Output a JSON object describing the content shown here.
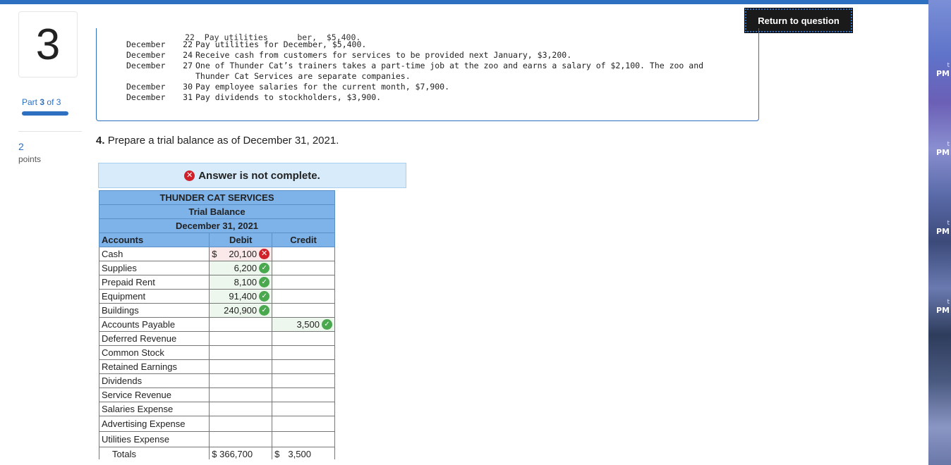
{
  "header": {
    "return_label": "Return to question"
  },
  "sidebar": {
    "question_number": "3",
    "part_prefix": "Part",
    "part_current": "3",
    "part_suffix": "of 3",
    "points_value": "2",
    "points_label": "points"
  },
  "problem": {
    "cut_line": "            22  Pay utilities      ber,  $5,400.",
    "entries": [
      {
        "month": "December",
        "day": "22",
        "text": "Pay utilities for December, $5,400."
      },
      {
        "month": "December",
        "day": "24",
        "text": "Receive cash from customers for services to be provided next January, $3,200."
      },
      {
        "month": "December",
        "day": "27",
        "text": "One of Thunder Cat’s trainers takes a part-time job at the zoo and earns a salary of $2,100. The zoo and Thunder Cat Services are separate companies."
      },
      {
        "month": "December",
        "day": "30",
        "text": "Pay employee salaries for the current month, $7,900."
      },
      {
        "month": "December",
        "day": "31",
        "text": "Pay dividends to stockholders, $3,900."
      }
    ]
  },
  "question": {
    "number": "4.",
    "text": "Prepare a trial balance as of December 31, 2021."
  },
  "feedback": {
    "status_text": "Answer is not complete."
  },
  "trial_balance": {
    "company": "THUNDER CAT SERVICES",
    "title": "Trial Balance",
    "date": "December 31, 2021",
    "col_accounts": "Accounts",
    "col_debit": "Debit",
    "col_credit": "Credit",
    "rows": [
      {
        "account": "Cash",
        "debit_sign": "$",
        "debit": "20,100",
        "credit": "",
        "status": "incorrect"
      },
      {
        "account": "Supplies",
        "debit": "6,200",
        "credit": "",
        "status": "correct"
      },
      {
        "account": "Prepaid Rent",
        "debit": "8,100",
        "credit": "",
        "status": "correct"
      },
      {
        "account": "Equipment",
        "debit": "91,400",
        "credit": "",
        "status": "correct"
      },
      {
        "account": "Buildings",
        "debit": "240,900",
        "credit": "",
        "status": "correct"
      },
      {
        "account": "Accounts Payable",
        "debit": "",
        "credit": "3,500",
        "status": "correct"
      },
      {
        "account": "Deferred Revenue",
        "debit": "",
        "credit": ""
      },
      {
        "account": "Common Stock",
        "debit": "",
        "credit": ""
      },
      {
        "account": "Retained Earnings",
        "debit": "",
        "credit": ""
      },
      {
        "account": "Dividends",
        "debit": "",
        "credit": ""
      },
      {
        "account": "Service Revenue",
        "debit": "",
        "credit": ""
      },
      {
        "account": "Salaries Expense",
        "debit": "",
        "credit": ""
      },
      {
        "account": "Advertising Expense",
        "debit": "",
        "credit": ""
      },
      {
        "account": "Utilities Expense",
        "debit": "",
        "credit": ""
      }
    ],
    "totals": {
      "label": "Totals",
      "debit": "$ 366,700",
      "credit_sign": "$",
      "credit": "3,500"
    }
  },
  "desktop_strip": {
    "labels": [
      "PM",
      "PM",
      "PM",
      "PM"
    ]
  },
  "colors": {
    "accent": "#2d6fc1",
    "header_blue": "#7eb3ea",
    "error_red": "#d0202a",
    "ok_green": "#4aa84f"
  }
}
